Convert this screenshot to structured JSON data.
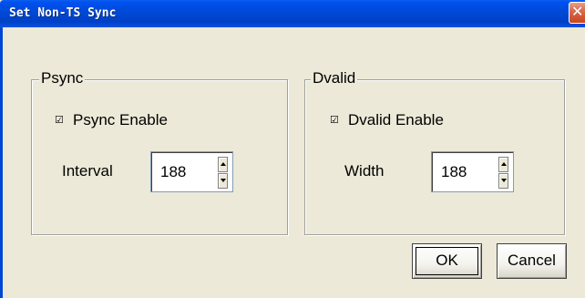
{
  "window": {
    "title": "Set Non-TS Sync",
    "close_glyph": "✕"
  },
  "psync": {
    "group_label": "Psync",
    "checkbox_glyph": "☑",
    "checkbox_label": "Psync Enable",
    "checked": true,
    "field_label": "Interval",
    "value": "188"
  },
  "dvalid": {
    "group_label": "Dvalid",
    "checkbox_glyph": "☑",
    "checkbox_label": "Dvalid Enable",
    "checked": true,
    "field_label": "Width",
    "value": "188"
  },
  "buttons": {
    "ok_label": "OK",
    "cancel_label": "Cancel"
  },
  "colors": {
    "titlebar": "#0049d6",
    "dialog_bg": "#ece9d8",
    "close_button": "#c8451f"
  },
  "icons": {
    "close": "close-icon",
    "spin_up": "chevron-up-icon",
    "spin_down": "chevron-down-icon",
    "checkbox": "checkmark-icon"
  }
}
